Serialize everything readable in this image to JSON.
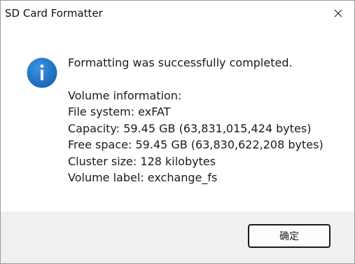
{
  "window": {
    "title": "SD Card Formatter",
    "close_icon": "close-icon"
  },
  "message": {
    "icon": "info-icon",
    "icon_color": "#1f73c9",
    "heading": "Formatting was successfully completed.",
    "lines": [
      "Volume information:",
      "File system: exFAT",
      "Capacity: 59.45 GB (63,831,015,424 bytes)",
      "Free space: 59.45 GB (63,830,622,208 bytes)",
      "Cluster size: 128 kilobytes",
      "Volume label: exchange_fs"
    ]
  },
  "buttons": {
    "ok_label": "确定"
  },
  "colors": {
    "footer_bg": "#f0f0f0",
    "dialog_bg": "#ffffff"
  }
}
